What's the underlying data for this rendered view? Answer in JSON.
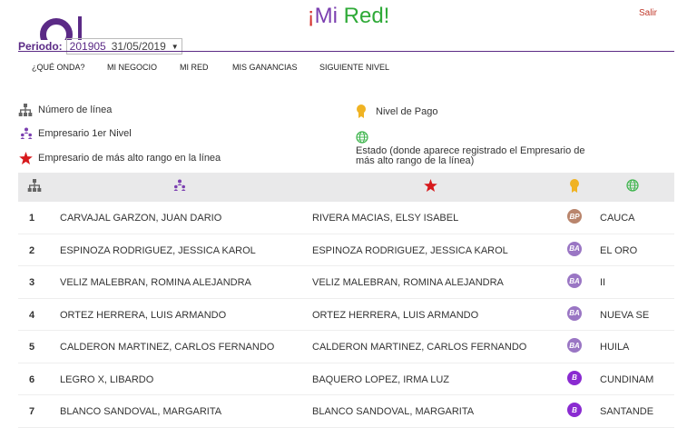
{
  "header": {
    "title_open": "¡",
    "title_mi": "Mi ",
    "title_red": "Red",
    "title_close": "!",
    "logout": "Salir"
  },
  "period": {
    "label": "Periodo:",
    "code": "201905",
    "date": "31/05/2019"
  },
  "nav": [
    "¿QUÉ ONDA?",
    "MI NEGOCIO",
    "MI RED",
    "MIS GANANCIAS",
    "SIGUIENTE NIVEL"
  ],
  "legend": {
    "line_number": "Número de línea",
    "first_level": "Empresario 1er Nivel",
    "highest_rank": "Empresario de más alto rango en la línea",
    "pay_level": "Nivel de Pago",
    "state": "Estado (donde aparece registrado el Empresario de más alto rango de la línea)"
  },
  "colors": {
    "purple": "#5b2a86",
    "star_red": "#d7191c",
    "medal_gold": "#f0b323",
    "globe_green": "#3cb44b",
    "badge_bp": "#b9856c",
    "badge_ba": "#9a76c4",
    "badge_b": "#8a2bd1"
  },
  "rows": [
    {
      "num": "1",
      "first_level": "CARVAJAL GARZON, JUAN DARIO",
      "highest": "RIVERA MACIAS, ELSY ISABEL",
      "pay": "BP",
      "state": "CAUCA"
    },
    {
      "num": "2",
      "first_level": "ESPINOZA RODRIGUEZ, JESSICA KAROL",
      "highest": "ESPINOZA RODRIGUEZ, JESSICA KAROL",
      "pay": "BA",
      "state": "EL ORO"
    },
    {
      "num": "3",
      "first_level": "VELIZ MALEBRAN, ROMINA ALEJANDRA",
      "highest": "VELIZ MALEBRAN, ROMINA ALEJANDRA",
      "pay": "BA",
      "state": "II"
    },
    {
      "num": "4",
      "first_level": "ORTEZ HERRERA, LUIS ARMANDO",
      "highest": "ORTEZ HERRERA, LUIS ARMANDO",
      "pay": "BA",
      "state": "NUEVA SE"
    },
    {
      "num": "5",
      "first_level": "CALDERON MARTINEZ, CARLOS FERNANDO",
      "highest": "CALDERON MARTINEZ, CARLOS FERNANDO",
      "pay": "BA",
      "state": "HUILA"
    },
    {
      "num": "6",
      "first_level": "LEGRO X, LIBARDO",
      "highest": "BAQUERO LOPEZ, IRMA LUZ",
      "pay": "B",
      "state": "CUNDINAM"
    },
    {
      "num": "7",
      "first_level": "BLANCO SANDOVAL, MARGARITA",
      "highest": "BLANCO SANDOVAL, MARGARITA",
      "pay": "B",
      "state": "SANTANDE"
    }
  ]
}
